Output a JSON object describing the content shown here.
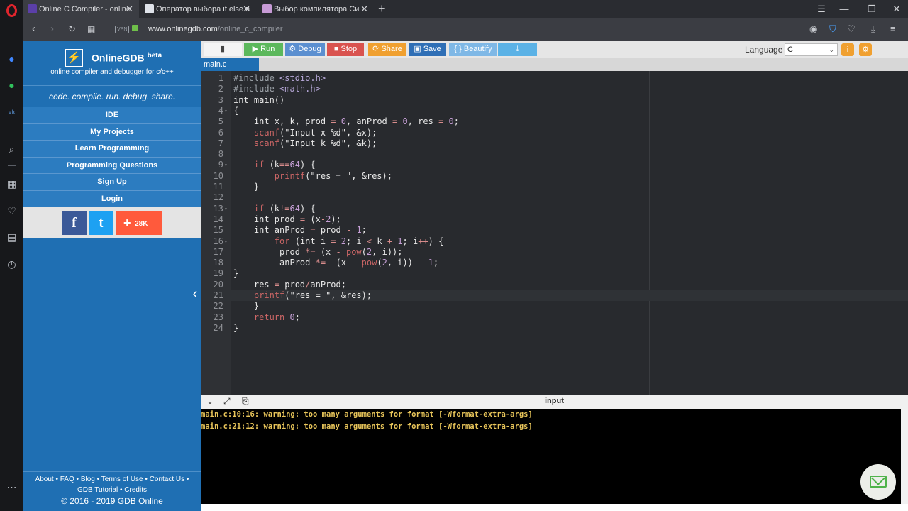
{
  "browser": {
    "tabs": [
      {
        "title": "Online C Compiler - online",
        "active": true
      },
      {
        "title": "Оператор выбора if else в",
        "active": false
      },
      {
        "title": "Выбор компилятора Си",
        "active": false
      }
    ],
    "new_tab": "+",
    "vpn": "VPN",
    "url_host": "www.onlinegdb.com",
    "url_path": "/online_c_compiler"
  },
  "sidebar": {
    "brand": "OnlineGDB",
    "brand_badge": "beta",
    "subtitle": "online compiler and debugger for c/c++",
    "tagline": "code. compile. run. debug. share.",
    "menu": [
      "IDE",
      "My Projects",
      "Learn Programming",
      "Programming Questions",
      "Sign Up",
      "Login"
    ],
    "social": {
      "facebook": "f",
      "twitter": "t",
      "share_count": "28K"
    },
    "footer": {
      "line1": "About • FAQ • Blog • Terms of Use • Contact Us •",
      "line2": "GDB Tutorial • Credits",
      "line3": "© 2016 - 2019 GDB Online"
    }
  },
  "toolbar": {
    "run": "Run",
    "debug": "Debug",
    "stop": "Stop",
    "share": "Share",
    "save": "Save",
    "beautify": "{ } Beautify",
    "language_label": "Language",
    "language_value": "C"
  },
  "file_tab": "main.c",
  "code_lines": [
    "#include <stdio.h>",
    "#include <math.h>",
    "int main()",
    "{",
    "    int x, k, prod = 0, anProd = 0, res = 0;",
    "    scanf(\"Input x %d\", &x);",
    "    scanf(\"Input k %d\", &k);",
    "",
    "    if (k==64) {",
    "        printf(\"res = \", &res);",
    "    }",
    "",
    "    if (k!=64) {",
    "    int prod = (x-2);",
    "    int anProd = prod - 1;",
    "        for (int i = 2; i < k + 1; i++) {",
    "         prod *= (x - pow(2, i));",
    "         anProd *=  (x - pow(2, i)) - 1;",
    "}",
    "    res = prod/anProd;",
    "    printf(\"res = \", &res);",
    "    }",
    "    return 0;",
    "}"
  ],
  "console": {
    "header_label": "input",
    "lines": [
      "main.c:10:16: warning: too many arguments for format [-Wformat-extra-args]",
      "main.c:21:12: warning: too many arguments for format [-Wformat-extra-args]"
    ]
  },
  "colors": {
    "sidebar": "#1f6fb3",
    "run": "#5cb85c",
    "debug": "#5b8fd0",
    "stop": "#d9534f",
    "share": "#f0a030",
    "save": "#2f6fb6",
    "beautify": "#7fb8e6",
    "download": "#5bb2e6"
  }
}
